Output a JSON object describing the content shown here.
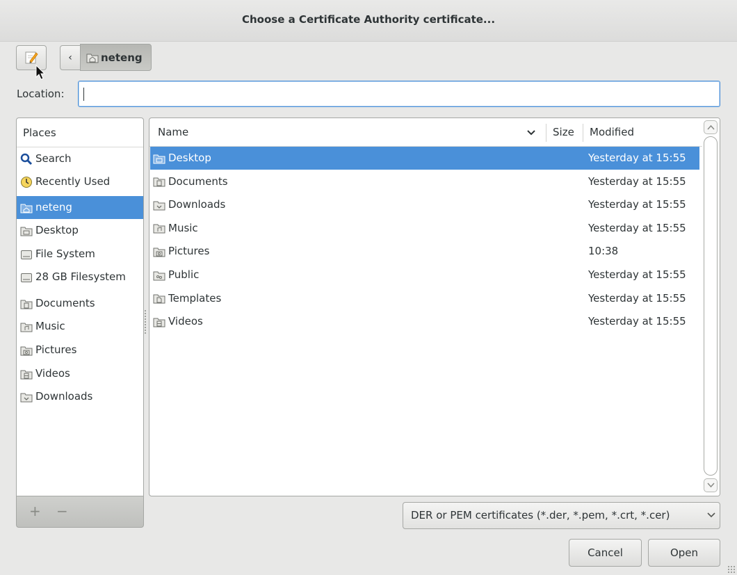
{
  "window": {
    "title": "Choose a Certificate Authority certificate..."
  },
  "toolbar": {
    "back_label": "‹",
    "current_folder": "neteng"
  },
  "location": {
    "label": "Location:",
    "value": ""
  },
  "places": {
    "header": "Places",
    "items": [
      {
        "label": "Search",
        "icon": "search-icon",
        "selected": false
      },
      {
        "label": "Recently Used",
        "icon": "clock-icon",
        "selected": false
      },
      {
        "label": "neteng",
        "icon": "home-folder-icon",
        "selected": true
      },
      {
        "label": "Desktop",
        "icon": "desktop-folder-icon",
        "selected": false
      },
      {
        "label": "File System",
        "icon": "drive-icon",
        "selected": false
      },
      {
        "label": "28 GB Filesystem",
        "icon": "drive-icon",
        "selected": false
      },
      {
        "label": "Documents",
        "icon": "documents-folder-icon",
        "selected": false
      },
      {
        "label": "Music",
        "icon": "music-folder-icon",
        "selected": false
      },
      {
        "label": "Pictures",
        "icon": "pictures-folder-icon",
        "selected": false
      },
      {
        "label": "Videos",
        "icon": "videos-folder-icon",
        "selected": false
      },
      {
        "label": "Downloads",
        "icon": "downloads-folder-icon",
        "selected": false
      }
    ],
    "add_label": "+",
    "remove_label": "−"
  },
  "files": {
    "columns": {
      "name": "Name",
      "size": "Size",
      "modified": "Modified"
    },
    "rows": [
      {
        "name": "Desktop",
        "size": "",
        "modified": "Yesterday at 15:55",
        "icon": "desktop-folder-icon",
        "selected": true
      },
      {
        "name": "Documents",
        "size": "",
        "modified": "Yesterday at 15:55",
        "icon": "documents-folder-icon",
        "selected": false
      },
      {
        "name": "Downloads",
        "size": "",
        "modified": "Yesterday at 15:55",
        "icon": "downloads-folder-icon",
        "selected": false
      },
      {
        "name": "Music",
        "size": "",
        "modified": "Yesterday at 15:55",
        "icon": "music-folder-icon",
        "selected": false
      },
      {
        "name": "Pictures",
        "size": "",
        "modified": "10:38",
        "icon": "pictures-folder-icon",
        "selected": false
      },
      {
        "name": "Public",
        "size": "",
        "modified": "Yesterday at 15:55",
        "icon": "public-folder-icon",
        "selected": false
      },
      {
        "name": "Templates",
        "size": "",
        "modified": "Yesterday at 15:55",
        "icon": "templates-folder-icon",
        "selected": false
      },
      {
        "name": "Videos",
        "size": "",
        "modified": "Yesterday at 15:55",
        "icon": "videos-folder-icon",
        "selected": false
      }
    ]
  },
  "filter": {
    "selected": "DER or PEM certificates (*.der, *.pem, *.crt, *.cer)"
  },
  "actions": {
    "cancel_label": "Cancel",
    "open_label": "Open"
  },
  "colors": {
    "selection": "#4a90d9",
    "folder": "#9c9e98",
    "background": "#e8e8e7"
  }
}
